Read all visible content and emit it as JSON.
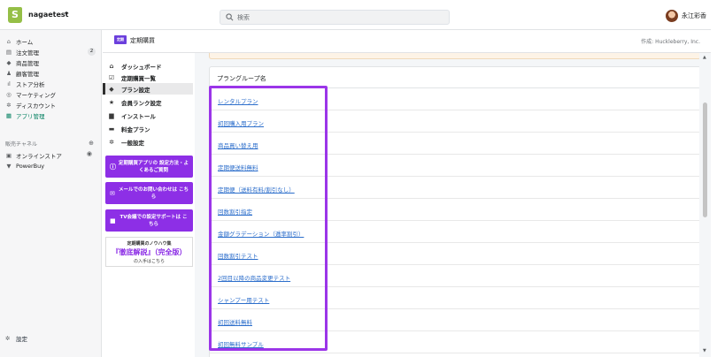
{
  "topbar": {
    "store_name": "nagaetest",
    "store_caret": "▾",
    "search_placeholder": "検索",
    "user_name": "永江彩香"
  },
  "sidebar": {
    "items": [
      {
        "label": "ホーム",
        "icon": "home-icon",
        "glyph": "⌂"
      },
      {
        "label": "注文管理",
        "icon": "orders-icon",
        "glyph": "▤",
        "badge": "2"
      },
      {
        "label": "商品管理",
        "icon": "tag-icon",
        "glyph": "◆"
      },
      {
        "label": "顧客管理",
        "icon": "person-icon",
        "glyph": "♟"
      },
      {
        "label": "ストア分析",
        "icon": "analytics-icon",
        "glyph": "ıl"
      },
      {
        "label": "マーケティング",
        "icon": "target-icon",
        "glyph": "◎"
      },
      {
        "label": "ディスカウント",
        "icon": "discount-icon",
        "glyph": "✲"
      },
      {
        "label": "アプリ管理",
        "icon": "apps-icon",
        "glyph": "▦",
        "active": true
      }
    ],
    "channels_heading": "販売チャネル",
    "channels": [
      {
        "label": "オンラインストア",
        "icon": "store-icon",
        "glyph": "▣"
      },
      {
        "label": "PowerBuy",
        "icon": "powerbuy-icon",
        "glyph": "▼"
      }
    ],
    "settings_label": "設定"
  },
  "app_header": {
    "icon_text": "定期",
    "title": "定期購買",
    "author": "作成: Huckleberry, Inc."
  },
  "app_menu": {
    "items": [
      {
        "label": "ダッシュボード",
        "glyph": "⌂"
      },
      {
        "label": "定期購買一覧",
        "glyph": "☑"
      },
      {
        "label": "プラン設定",
        "glyph": "◆",
        "active": true
      },
      {
        "label": "会員ランク設定",
        "glyph": "★"
      },
      {
        "label": "インストール",
        "glyph": "▆"
      },
      {
        "label": "料金プラン",
        "glyph": "▬"
      },
      {
        "label": "一般設定",
        "glyph": "✲"
      }
    ],
    "promos": [
      {
        "text": "定期購買アプリの 設定方法・よくあるご質問",
        "glyph": "ⓘ"
      },
      {
        "text": "メールでのお問い合わせは こちら",
        "glyph": "✉"
      },
      {
        "text": "TV会議での設定サポートは こちら",
        "glyph": "■"
      }
    ],
    "knowhow": {
      "line1": "定期購買のノウハウ集",
      "line2": "『徹底解説』（完全版）",
      "line3": "の入手はこちら"
    }
  },
  "main": {
    "card_title": "プラングループ名",
    "plans": [
      "レンタルプラン",
      "初回購入用プラン",
      "商品買い替え用",
      "定期便送料無料",
      "定期便（送料有料/割引なし）",
      "回数割引指定",
      "金額グラデーション（逓率割引）",
      "回数割引テスト",
      "2回目以降の商品変更テスト",
      "シャンプー用テスト",
      "初回送料無料",
      "初回無料サンプル"
    ]
  },
  "colors": {
    "accent": "#9b35e8",
    "link": "#2c6ecb",
    "active_nav": "#007f5f",
    "promo_bg": "#8d2fe6"
  }
}
